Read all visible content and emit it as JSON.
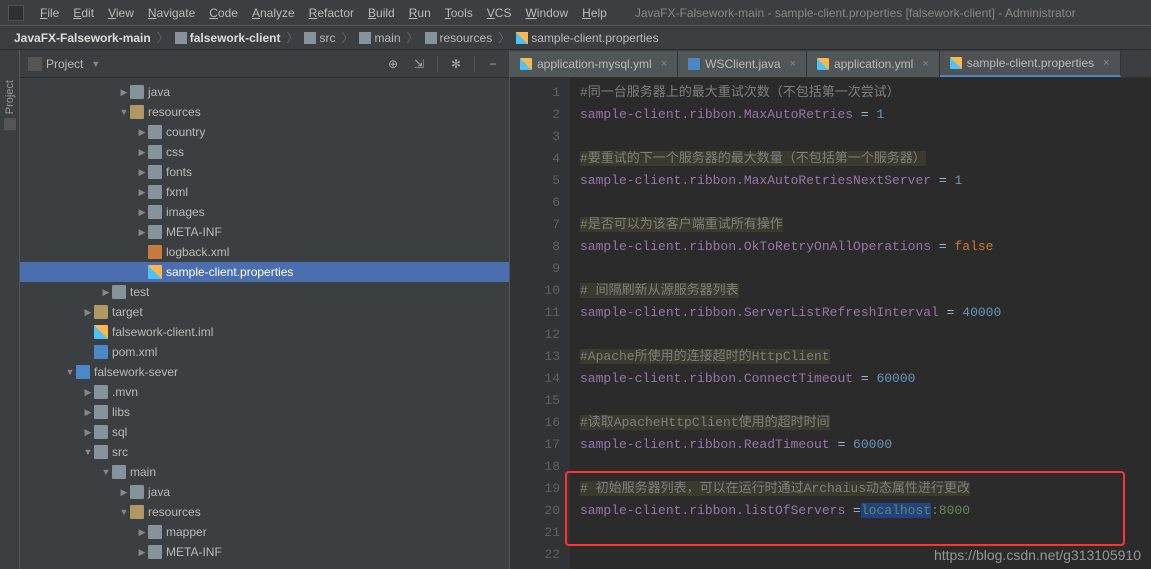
{
  "window_title": "JavaFX-Falsework-main - sample-client.properties [falsework-client] - Administrator",
  "menus": [
    "File",
    "Edit",
    "View",
    "Navigate",
    "Code",
    "Analyze",
    "Refactor",
    "Build",
    "Run",
    "Tools",
    "VCS",
    "Window",
    "Help"
  ],
  "breadcrumb": [
    {
      "label": "JavaFX-Falsework-main",
      "bold": true
    },
    {
      "label": "falsework-client",
      "bold": true,
      "icon": "folder"
    },
    {
      "label": "src",
      "icon": "folder"
    },
    {
      "label": "main",
      "icon": "folder"
    },
    {
      "label": "resources",
      "icon": "folder"
    },
    {
      "label": "sample-client.properties",
      "icon": "props"
    }
  ],
  "sidebar_label": "Project",
  "panel_title": "Project",
  "tree": [
    {
      "indent": 5,
      "arrow": ">",
      "icon": "tfolder",
      "label": "java"
    },
    {
      "indent": 5,
      "arrow": "v",
      "icon": "tfolder-yellow",
      "label": "resources"
    },
    {
      "indent": 6,
      "arrow": ">",
      "icon": "tfolder",
      "label": "country"
    },
    {
      "indent": 6,
      "arrow": ">",
      "icon": "tfolder",
      "label": "css"
    },
    {
      "indent": 6,
      "arrow": ">",
      "icon": "tfolder",
      "label": "fonts"
    },
    {
      "indent": 6,
      "arrow": ">",
      "icon": "tfolder",
      "label": "fxml"
    },
    {
      "indent": 6,
      "arrow": ">",
      "icon": "tfolder",
      "label": "images"
    },
    {
      "indent": 6,
      "arrow": ">",
      "icon": "tfolder",
      "label": "META-INF"
    },
    {
      "indent": 6,
      "arrow": "",
      "icon": "tfile-xml",
      "label": "logback.xml"
    },
    {
      "indent": 6,
      "arrow": "",
      "icon": "tfile-props",
      "label": "sample-client.properties",
      "selected": true
    },
    {
      "indent": 4,
      "arrow": ">",
      "icon": "tfolder",
      "label": "test"
    },
    {
      "indent": 3,
      "arrow": ">",
      "icon": "tfolder-yellow",
      "label": "target"
    },
    {
      "indent": 3,
      "arrow": "",
      "icon": "tfile-props",
      "label": "falsework-client.iml"
    },
    {
      "indent": 3,
      "arrow": "",
      "icon": "tfile-m",
      "label": "pom.xml"
    },
    {
      "indent": 2,
      "arrow": "v",
      "icon": "tfolder-blue",
      "label": "falsework-sever"
    },
    {
      "indent": 3,
      "arrow": ">",
      "icon": "tfolder",
      "label": ".mvn"
    },
    {
      "indent": 3,
      "arrow": ">",
      "icon": "tfolder",
      "label": "libs"
    },
    {
      "indent": 3,
      "arrow": ">",
      "icon": "tfolder",
      "label": "sql"
    },
    {
      "indent": 3,
      "arrow": "v",
      "icon": "tfolder",
      "label": "src"
    },
    {
      "indent": 4,
      "arrow": "v",
      "icon": "tfolder",
      "label": "main"
    },
    {
      "indent": 5,
      "arrow": ">",
      "icon": "tfolder",
      "label": "java"
    },
    {
      "indent": 5,
      "arrow": "v",
      "icon": "tfolder-yellow",
      "label": "resources"
    },
    {
      "indent": 6,
      "arrow": ">",
      "icon": "tfolder",
      "label": "mapper"
    },
    {
      "indent": 6,
      "arrow": ">",
      "icon": "tfolder",
      "label": "META-INF"
    }
  ],
  "tabs": [
    {
      "label": "application-mysql.yml",
      "icon": "tfile-props"
    },
    {
      "label": "WSClient.java",
      "icon": "tfile-m"
    },
    {
      "label": "application.yml",
      "icon": "tfile-props"
    },
    {
      "label": "sample-client.properties",
      "icon": "tfile-props",
      "active": true
    }
  ],
  "code_lines": [
    {
      "n": 1,
      "type": "comment",
      "text": "#同一台服务器上的最大重试次数（不包括第一次尝试）"
    },
    {
      "n": 2,
      "type": "prop",
      "key": "sample-client.ribbon.MaxAutoRetries",
      "val": "1",
      "valtype": "num"
    },
    {
      "n": 3,
      "type": "blank"
    },
    {
      "n": 4,
      "type": "comment-hl",
      "text": "#要重试的下一个服务器的最大数量（不包括第一个服务器）"
    },
    {
      "n": 5,
      "type": "prop",
      "key": "sample-client.ribbon.MaxAutoRetriesNextServer",
      "val": "1",
      "valtype": "num"
    },
    {
      "n": 6,
      "type": "blank"
    },
    {
      "n": 7,
      "type": "comment-hl",
      "text": "#是否可以为该客户端重试所有操作"
    },
    {
      "n": 8,
      "type": "prop",
      "key": "sample-client.ribbon.OkToRetryOnAllOperations",
      "val": "false",
      "valtype": "kw"
    },
    {
      "n": 9,
      "type": "blank"
    },
    {
      "n": 10,
      "type": "comment-hl",
      "text": "# 间隔刷新从源服务器列表"
    },
    {
      "n": 11,
      "type": "prop",
      "key": "sample-client.ribbon.ServerListRefreshInterval",
      "val": "40000",
      "valtype": "num"
    },
    {
      "n": 12,
      "type": "blank"
    },
    {
      "n": 13,
      "type": "comment-hl",
      "text": "#Apache所使用的连接超时的HttpClient"
    },
    {
      "n": 14,
      "type": "prop",
      "key": "sample-client.ribbon.ConnectTimeout",
      "val": "60000",
      "valtype": "num"
    },
    {
      "n": 15,
      "type": "blank"
    },
    {
      "n": 16,
      "type": "comment-hl",
      "text": "#读取ApacheHttpClient使用的超时时间"
    },
    {
      "n": 17,
      "type": "prop",
      "key": "sample-client.ribbon.ReadTimeout",
      "val": "60000",
      "valtype": "num"
    },
    {
      "n": 18,
      "type": "blank"
    },
    {
      "n": 19,
      "type": "comment-hl",
      "text": "# 初始服务器列表，可以在运行时通过Archaius动态属性进行更改"
    },
    {
      "n": 20,
      "type": "prop-hl",
      "key": "sample-client.ribbon.listOfServers",
      "val_pre": "",
      "val_hl": "localhost",
      "val_post": ":8000"
    },
    {
      "n": 21,
      "type": "blank"
    },
    {
      "n": 22,
      "type": "blank"
    }
  ],
  "watermark": "https://blog.csdn.net/g313105910"
}
